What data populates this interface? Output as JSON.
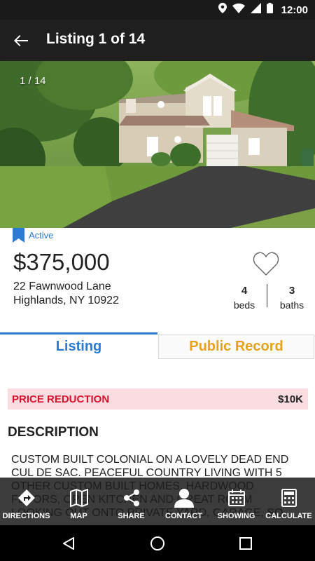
{
  "status_bar": {
    "time": "12:00",
    "icons": [
      "location-icon",
      "wifi-icon",
      "signal-icon",
      "battery-icon"
    ]
  },
  "app_bar": {
    "title": "Listing 1 of 14",
    "back_icon": "arrow-left-icon"
  },
  "photo": {
    "counter": "1 / 14"
  },
  "listing": {
    "status": "Active",
    "price": "$375,000",
    "address_line1": "22 Fawnwood Lane",
    "address_line2": "Highlands, NY 10922",
    "beds_value": "4",
    "beds_label": "beds",
    "baths_value": "3",
    "baths_label": "baths",
    "favorite_icon": "heart-outline-icon"
  },
  "tabs": {
    "listing": "Listing",
    "public_record": "Public Record"
  },
  "price_reduction": {
    "label": "PRICE REDUCTION",
    "amount": "$10K"
  },
  "description": {
    "heading": "DESCRIPTION",
    "text": "CUSTOM BUILT COLONIAL ON A LOVELY DEAD END CUL DE SAC. PEACEFUL COUNTRY LIVING WITH 5 OTHER CUSTOM BUILT HOMES. HARDWOOD FLOORS, OPEN KITCHEN AND GREAT ROOM LOOKING OUT ONTO PRIVATE YARD, GARAGE, SO"
  },
  "bottom_bar": {
    "directions": "DIRECTIONS",
    "map": "MAP",
    "share": "SHARE",
    "contact": "CONTACT",
    "showing": "SHOWING",
    "calculate": "CALCULATE"
  },
  "colors": {
    "accent_blue": "#2a7bd4",
    "accent_orange": "#e8a21a",
    "reduction_red": "#d8102c",
    "reduction_bg": "#fbdde1",
    "app_bar": "#1f1f1f"
  }
}
